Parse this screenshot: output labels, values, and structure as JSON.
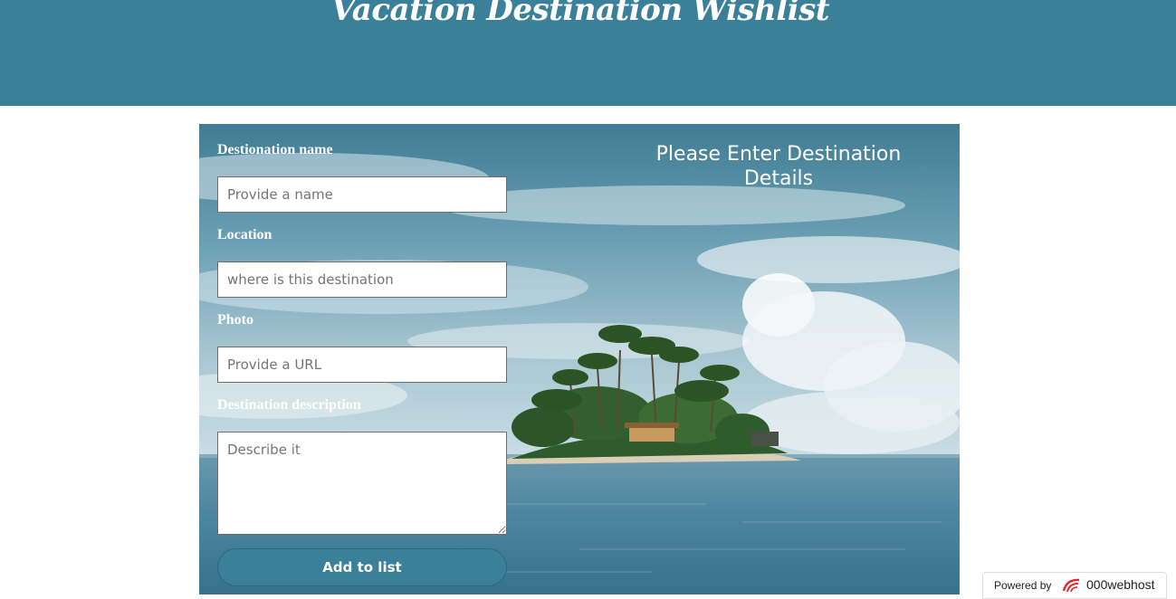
{
  "header": {
    "title": "Vacation Destination Wishlist"
  },
  "form": {
    "name_label": "Destionation name",
    "name_placeholder": "Provide a name",
    "location_label": "Location",
    "location_placeholder": "where is this destination",
    "photo_label": "Photo",
    "photo_placeholder": "Provide a URL",
    "description_label": "Destination description",
    "description_placeholder": "Describe it",
    "submit_label": "Add to list"
  },
  "details": {
    "title": "Please Enter Destination Details"
  },
  "footer_badge": {
    "prefix": "Powered by",
    "brand": "000webhost"
  },
  "colors": {
    "header_bg": "#3a8099",
    "button_bg": "#3a8099"
  }
}
